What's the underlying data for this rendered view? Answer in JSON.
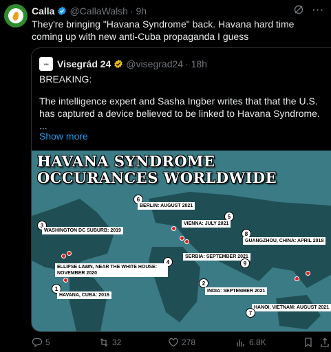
{
  "tweet": {
    "name": "Calla",
    "handle": "@CallaWalsh",
    "time": "· 9h",
    "text": "They're bringing \"Havana Syndrome\" back. Havana hard time coming up with new anti-Cuba propaganda I guess"
  },
  "quote": {
    "name": "Visegrád 24",
    "handle": "@visegrad24",
    "time": "· 18h",
    "line1": "BREAKING:",
    "line2": "The intelligence expert and Sasha Ingber writes that that the U.S. has captured a device believed to be linked to Havana Syndrome.",
    "line3": "...",
    "show_more": "Show more"
  },
  "map": {
    "title_line1": "HAVANA SYNDROME",
    "title_line2": "OCCURANCES WORLDWIDE",
    "labels": [
      {
        "num": "1",
        "text": "HAVANA, CUBA: 2016"
      },
      {
        "num": "2",
        "text": "INDIA: SEPTEMBER 2021"
      },
      {
        "num": "3",
        "text": "WASHINGTON DC SUBURB: 2019"
      },
      {
        "num": "4",
        "text": "ELLIPSE LAWN, NEAR THE WHITE HOUSE: NOVEMBER 2020"
      },
      {
        "num": "5",
        "text": "VIENNA: JULY 2021"
      },
      {
        "num": "6",
        "text": "BERLIN: AUGUST 2021"
      },
      {
        "num": "7",
        "text": "HANOI, VIETNAM: AUGUST 2021"
      },
      {
        "num": "8",
        "text": "GUANGZHOU, CHINA: APRIL 2018"
      },
      {
        "num": "9",
        "text": "SERBIA: SEPTEMBER 2021"
      }
    ]
  },
  "actions": {
    "replies": "5",
    "retweets": "32",
    "likes": "278",
    "views": "6.8K"
  },
  "colors": {
    "accent": "#1d9bf0",
    "verified_blue": "#1d9bf0",
    "verified_gold": "#e2b719",
    "map_ocean": "#3a7b85",
    "map_land": "#1f4f55"
  }
}
